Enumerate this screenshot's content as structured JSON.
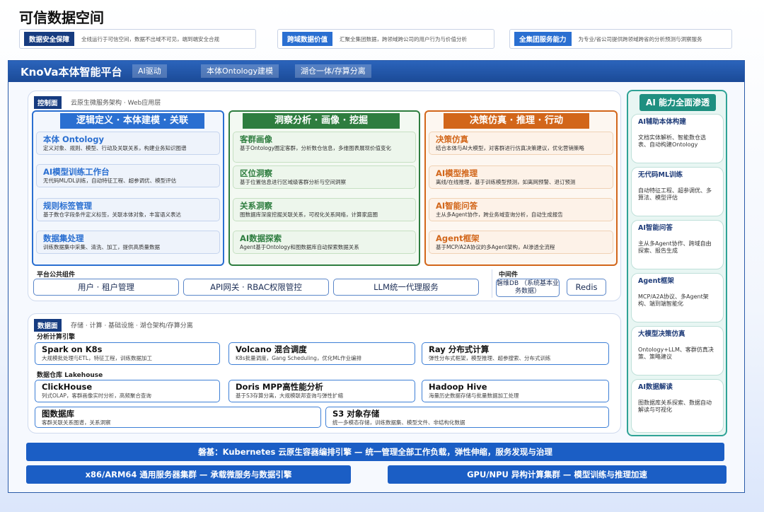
{
  "page_title": "可信数据空间",
  "value_cards": [
    {
      "tag": "数据安全保障",
      "text": "全线运行于可信空间，数据不出域不可见，端到端安全合规"
    },
    {
      "tag": "跨域数据价值",
      "text": "汇聚全集团数据，跨领域跨公司的用户行为与价值分析"
    },
    {
      "tag": "全集团服务能力",
      "text": "为专业/省公司提供跨领域跨省的分析预测与洞察服务"
    }
  ],
  "platform": {
    "title": "KnoVa本体智能平台",
    "tags": [
      "AI驱动",
      "本体Ontology建模",
      "湖仓一体/存算分离"
    ]
  },
  "control_plane": {
    "label": "控制面",
    "desc": "云原生微服务架构 · Web应用层",
    "columns": [
      {
        "header": "逻辑定义 · 本体建模 · 关联",
        "cards": [
          {
            "title": "本体 Ontology",
            "desc": "定义对象、规则、模型、行动及关联关系，构建业务知识图谱"
          },
          {
            "title": "AI模型训练工作台",
            "desc": "无代码ML/DL训练，自动特征工程、超参调优、模型评估"
          },
          {
            "title": "规则标签管理",
            "desc": "基于数仓字段条件定义标签，关联本体对象，丰富语义表达"
          },
          {
            "title": "数据集处理",
            "desc": "训练数据集中采集、清洗、加工，提供高质量数据"
          }
        ]
      },
      {
        "header": "洞察分析 · 画像 · 挖掘",
        "cards": [
          {
            "title": "客群画像",
            "desc": "基于Ontology圈定客群，分析数仓信息，多维图表展现价值变化"
          },
          {
            "title": "区位洞察",
            "desc": "基于位置信息进行区域级客群分析与空间洞察"
          },
          {
            "title": "关系洞察",
            "desc": "图数据库深度挖掘关联关系，可视化关系网络，计算家庭圈"
          },
          {
            "title": "AI数据探索",
            "desc": "Agent基于Ontology和图数据库自动探索数据关系"
          }
        ]
      },
      {
        "header": "决策仿真 · 推理 · 行动",
        "cards": [
          {
            "title": "决策仿真",
            "desc": "结合本体与AI大模型，对客群进行仿真决策建议，优化营销策略"
          },
          {
            "title": "AI模型推理",
            "desc": "离线/在线推理，基于训练模型预测，如离网预警、退订预测"
          },
          {
            "title": "AI智能问答",
            "desc": "主从多Agent协作，跨业务域查询分析，自动生成报告"
          },
          {
            "title": "Agent框架",
            "desc": "基于MCP/A2A协议的多Agent架构，AI渗透全流程"
          }
        ]
      }
    ],
    "public_components_label": "平台公共组件",
    "public_components": [
      "用户 · 租户管理",
      "API网关 · RBAC权限管控",
      "LLM统一代理服务"
    ],
    "middleware_label": "中间件",
    "middleware": [
      "磐维DB （系统基本业务数据）",
      "Redis"
    ]
  },
  "data_plane": {
    "label": "数据面",
    "desc": "存储 · 计算 · 基础设施 · 湖仓架构/存算分离",
    "compute_label": "分析计算引擎",
    "compute": [
      {
        "title": "Spark on K8s",
        "desc": "大规模批处理与ETL，特征工程，训练数据加工"
      },
      {
        "title": "Volcano 混合调度",
        "desc": "K8s批量调度，Gang Scheduling，优化ML作业编排"
      },
      {
        "title": "Ray 分布式计算",
        "desc": "弹性分布式框架，模型推理、超参搜索、分布式训练"
      }
    ],
    "lakehouse_label": "数据仓库 Lakehouse",
    "lakehouse": [
      {
        "title": "ClickHouse",
        "desc": "列式OLAP，客群画像实时分析，高频聚合查询"
      },
      {
        "title": "Doris MPP高性能分析",
        "desc": "基于S3存算分离，大规模联邦查询与弹性扩缩"
      },
      {
        "title": "Hadoop Hive",
        "desc": "海量历史数据存储与批量数据加工处理"
      }
    ],
    "storage": [
      {
        "title": "图数据库",
        "desc": "客群关联关系图谱，关系洞察"
      },
      {
        "title": "S3 对象存储",
        "desc": "统一多模态存储，训练数据集、模型文件、非结构化数据"
      }
    ]
  },
  "ai_panel": {
    "title": "AI 能力全面渗透",
    "items": [
      {
        "title": "AI辅助本体构建",
        "desc": "文档实体解析、智能数仓选表、自动构建Ontology"
      },
      {
        "title": "无代码ML训练",
        "desc": "自动特征工程、超参调优、多算法、模型评估"
      },
      {
        "title": "AI智能问答",
        "desc": "主从多Agent协作、跨域自由探索、报告生成"
      },
      {
        "title": "Agent框架",
        "desc": "MCP/A2A协议、多Agent架构、端到端智能化"
      },
      {
        "title": "大模型决策仿真",
        "desc": "Ontology+LLM、客群仿真决策、策略建议"
      },
      {
        "title": "AI数据解读",
        "desc": "图数据库关系探索、数据自动解读与可视化"
      }
    ]
  },
  "bottom_bars": {
    "k8s": "磐基：Kubernetes 云原生容器编排引擎 — 统一管理全部工作负载，弹性伸缩，服务发现与治理",
    "x86": "x86/ARM64 通用服务器集群 — 承载微服务与数据引擎",
    "gpu": "GPU/NPU 异构计算集群 — 模型训练与推理加速"
  },
  "colors": {
    "navy": "#173c80",
    "blue": "#2a6fd1",
    "green": "#2e7d3f",
    "orange": "#d2661a",
    "teal": "#1e8f80"
  }
}
